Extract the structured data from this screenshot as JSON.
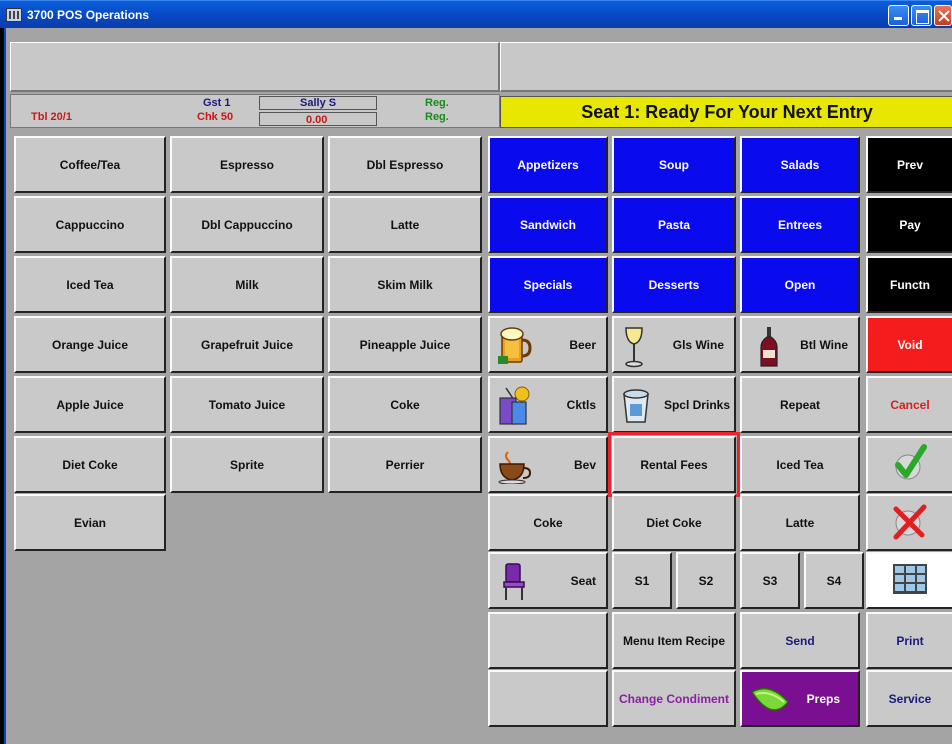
{
  "window": {
    "title": "3700 POS Operations"
  },
  "info": {
    "table": "Tbl 20/1",
    "guest": "Gst 1",
    "check": "Chk 50",
    "employee": "Sally S",
    "amount": "0.00",
    "reg1": "Reg.",
    "reg2": "Reg."
  },
  "status": {
    "message": "Seat 1: Ready For Your Next Entry"
  },
  "beverages": [
    "Coffee/Tea",
    "Espresso",
    "Dbl Espresso",
    "Cappuccino",
    "Dbl Cappuccino",
    "Latte",
    "Iced Tea",
    "Milk",
    "Skim Milk",
    "Orange Juice",
    "Grapefruit Juice",
    "Pineapple Juice",
    "Apple Juice",
    "Tomato Juice",
    "Coke",
    "Diet Coke",
    "Sprite",
    "Perrier",
    "Evian"
  ],
  "categories": {
    "appetizers": "Appetizers",
    "soup": "Soup",
    "salads": "Salads",
    "sandwich": "Sandwich",
    "pasta": "Pasta",
    "entrees": "Entrees",
    "specials": "Specials",
    "desserts": "Desserts",
    "open": "Open"
  },
  "functions": {
    "prev": "Prev",
    "pay": "Pay",
    "functn": "Functn",
    "void": "Void",
    "cancel": "Cancel",
    "print": "Print",
    "service": "Service",
    "send": "Send"
  },
  "drinks": {
    "beer": "Beer",
    "gls_wine": "Gls Wine",
    "btl_wine": "Btl Wine",
    "cktls": "Cktls",
    "spcl_drinks": "Spcl Drinks",
    "repeat": "Repeat",
    "bev": "Bev",
    "rental_fees": "Rental Fees",
    "iced_tea": "Iced Tea",
    "coke": "Coke",
    "diet_coke": "Diet Coke",
    "latte": "Latte"
  },
  "seats": {
    "seat": "Seat",
    "s1": "S1",
    "s2": "S2",
    "s3": "S3",
    "s4": "S4"
  },
  "misc": {
    "menu_item_recipe": "Menu Item Recipe",
    "change_condiment": "Change Condiment",
    "preps": "Preps"
  },
  "colors": {
    "accent_blue": "#0a0aee",
    "status_yellow": "#e7e700",
    "void_red": "#f41c1c",
    "preps_purple": "#7a0f92",
    "highlight": "#e8252e"
  }
}
